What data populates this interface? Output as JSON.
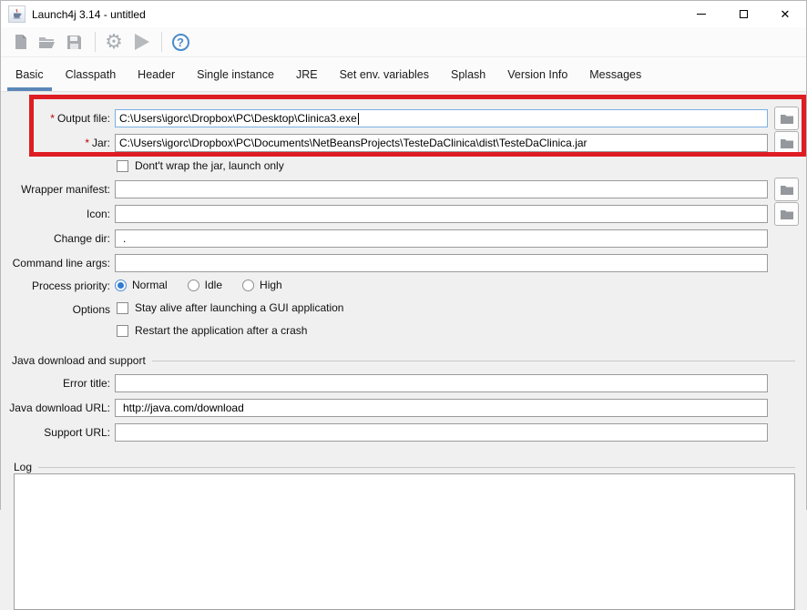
{
  "window": {
    "title": "Launch4j 3.14 - untitled"
  },
  "icons": {
    "app_icon": "java-cup-icon",
    "toolbar": [
      "new-config-icon",
      "open-config-icon",
      "save-config-icon",
      "build-wrapper-gear-icon",
      "test-wrapper-play-icon",
      "help-icon"
    ],
    "help_glyph": "?",
    "browse_button_icon": "folder-icon",
    "window_controls": [
      "minimize-icon",
      "maximize-icon",
      "close-icon"
    ],
    "close_glyph": "✕"
  },
  "tabs": [
    {
      "label": "Basic",
      "selected": true
    },
    {
      "label": "Classpath",
      "selected": false
    },
    {
      "label": "Header",
      "selected": false
    },
    {
      "label": "Single instance",
      "selected": false
    },
    {
      "label": "JRE",
      "selected": false
    },
    {
      "label": "Set env. variables",
      "selected": false
    },
    {
      "label": "Splash",
      "selected": false
    },
    {
      "label": "Version Info",
      "selected": false
    },
    {
      "label": "Messages",
      "selected": false
    }
  ],
  "form": {
    "required_marker": "*",
    "output_file": {
      "label": "Output file:",
      "value": "C:\\Users\\igorc\\Dropbox\\PC\\Desktop\\Clinica3.exe",
      "required": true,
      "focused": true
    },
    "jar": {
      "label": "Jar:",
      "value": "C:\\Users\\igorc\\Dropbox\\PC\\Documents\\NetBeansProjects\\TesteDaClinica\\dist\\TesteDaClinica.jar",
      "required": true
    },
    "dont_wrap": {
      "label": "Dont't wrap the jar, launch only",
      "checked": false
    },
    "wrapper_manifest": {
      "label": "Wrapper manifest:",
      "value": ""
    },
    "icon": {
      "label": "Icon:",
      "value": ""
    },
    "change_dir": {
      "label": "Change dir:",
      "value": "."
    },
    "cmd_args": {
      "label": "Command line args:",
      "value": ""
    },
    "priority": {
      "label": "Process priority:",
      "options": [
        {
          "label": "Normal",
          "selected": true
        },
        {
          "label": "Idle",
          "selected": false
        },
        {
          "label": "High",
          "selected": false
        }
      ]
    },
    "options": {
      "label": "Options",
      "stay_alive": {
        "label": "Stay alive after launching a GUI application",
        "checked": false
      },
      "restart": {
        "label": "Restart the application after a crash",
        "checked": false
      }
    },
    "java_group": {
      "title": "Java download and support",
      "error_title": {
        "label": "Error title:",
        "value": ""
      },
      "download_url": {
        "label": "Java download URL:",
        "value": "http://java.com/download"
      },
      "support_url": {
        "label": "Support URL:",
        "value": ""
      }
    },
    "log_group": {
      "title": "Log",
      "content": ""
    }
  },
  "colors": {
    "highlight_rect": "#de1d23",
    "tab_accent": "#5b87b8",
    "focus_border": "#7ab0e2",
    "radio_selected": "#2f7cd3",
    "help_blue": "#4b8bcb",
    "required_red": "#c40000",
    "background": "#f0f0f0"
  }
}
